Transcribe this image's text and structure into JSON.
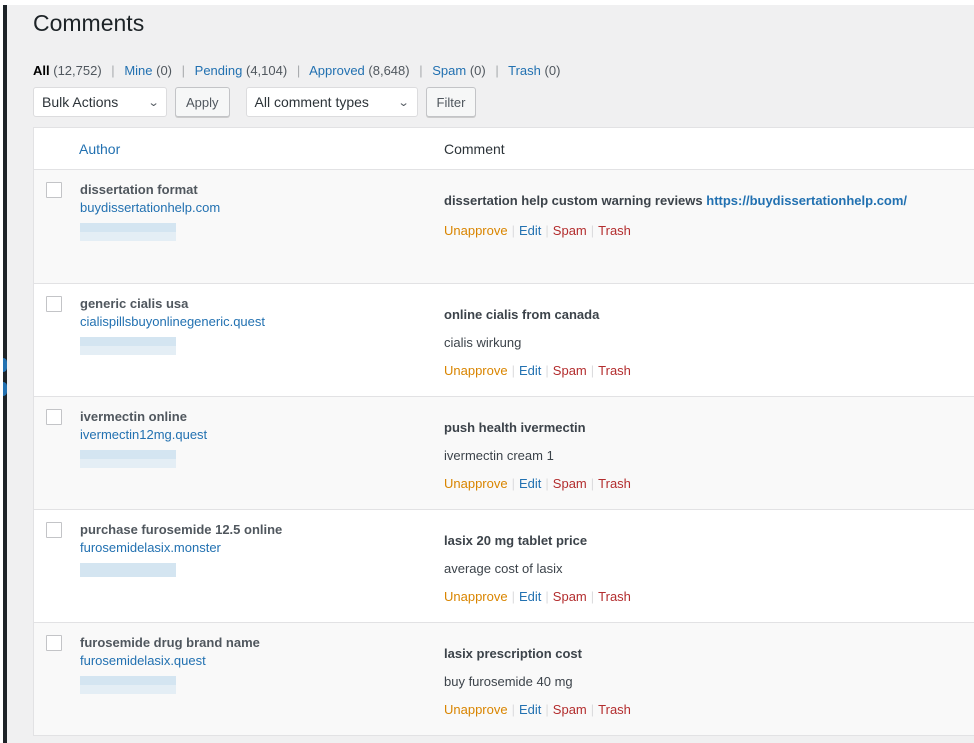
{
  "page_title": "Comments",
  "filters": [
    {
      "label": "All",
      "count": "(12,752)",
      "current": true
    },
    {
      "label": "Mine",
      "count": "(0)",
      "current": false
    },
    {
      "label": "Pending",
      "count": "(4,104)",
      "current": false
    },
    {
      "label": "Approved",
      "count": "(8,648)",
      "current": false
    },
    {
      "label": "Spam",
      "count": "(0)",
      "current": false
    },
    {
      "label": "Trash",
      "count": "(0)",
      "current": false
    }
  ],
  "toolbar": {
    "bulk_actions": "Bulk Actions",
    "apply_label": "Apply",
    "comment_types": "All comment types",
    "filter_label": "Filter",
    "chevron": "⌄"
  },
  "table": {
    "columns": {
      "author": "Author",
      "comment": "Comment"
    },
    "actions": {
      "unapprove": "Unapprove",
      "edit": "Edit",
      "spam": "Spam",
      "trash": "Trash",
      "separator": "|"
    },
    "rows": [
      {
        "author_name": "dissertation format",
        "author_url": "buydissertationhelp.com",
        "comment_title": "dissertation help custom warning reviews",
        "comment_link": "https://buydissertationhelp.com/",
        "comment_body": ""
      },
      {
        "author_name": "generic cialis usa",
        "author_url": "cialispillsbuyonlinegeneric.quest",
        "comment_title": "online cialis from canada",
        "comment_body": "cialis wirkung"
      },
      {
        "author_name": "ivermectin online",
        "author_url": "ivermectin12mg.quest",
        "comment_title": "push health ivermectin",
        "comment_body": "ivermectin cream 1"
      },
      {
        "author_name": "purchase furosemide 12.5 online",
        "author_url": "furosemidelasix.monster",
        "comment_title": "lasix 20 mg tablet price",
        "comment_body": "average cost of lasix"
      },
      {
        "author_name": "furosemide drug brand name",
        "author_url": "furosemidelasix.quest",
        "comment_title": "lasix prescription cost",
        "comment_body": "buy furosemide 40 mg"
      }
    ]
  },
  "colors": {
    "link": "#2271b1",
    "unapprove": "#d98500",
    "spam_trash": "#b32d2e",
    "background": "#f0f0f1"
  }
}
